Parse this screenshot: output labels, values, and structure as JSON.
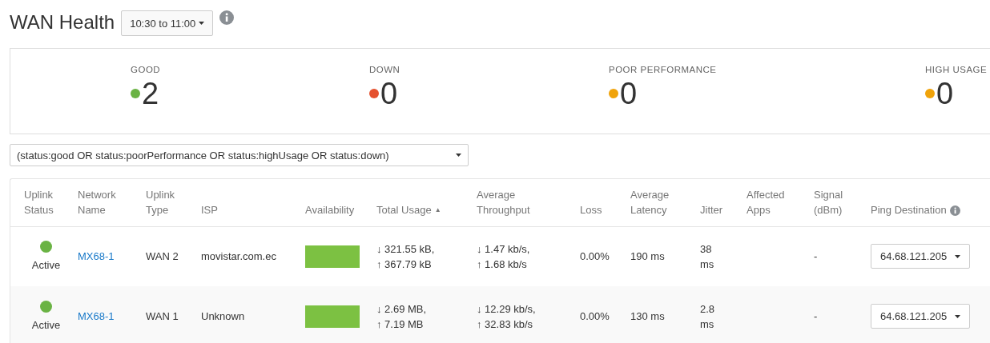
{
  "title": "WAN Health",
  "time_range": "10:30 to 11:00",
  "summary": [
    {
      "label": "GOOD",
      "count": "2",
      "color": "#6ab344"
    },
    {
      "label": "DOWN",
      "count": "0",
      "color": "#e5512f"
    },
    {
      "label": "POOR PERFORMANCE",
      "count": "0",
      "color": "#f0a30a"
    },
    {
      "label": "HIGH USAGE",
      "count": "0",
      "color": "#f0a30a"
    }
  ],
  "filter": {
    "value": "(status:good OR status:poorPerformance OR status:highUsage OR status:down)"
  },
  "table": {
    "columns": [
      {
        "label": "Uplink Status"
      },
      {
        "label": "Network Name"
      },
      {
        "label": "Uplink Type"
      },
      {
        "label": "ISP"
      },
      {
        "label": "Availability"
      },
      {
        "label": "Total Usage",
        "sort_mark": "▲"
      },
      {
        "label": "Average Throughput"
      },
      {
        "label": "Loss"
      },
      {
        "label": "Average Latency"
      },
      {
        "label": "Jitter"
      },
      {
        "label": "Affected Apps"
      },
      {
        "label": "Signal (dBm)"
      },
      {
        "label": "Ping Destination",
        "info": true
      }
    ],
    "rows": [
      {
        "status": "Active",
        "color": "#6ab344",
        "network": "MX68-1",
        "type": "WAN 2",
        "isp": "movistar.com.ec",
        "usage": [
          "↓ 321.55 kB,",
          "↑ 367.79 kB"
        ],
        "throughput": [
          "↓ 1.47 kb/s,",
          "↑ 1.68 kb/s"
        ],
        "loss": "0.00%",
        "latency": "190 ms",
        "jitter": "38 ms",
        "signal": "-",
        "ping": "64.68.121.205"
      },
      {
        "status": "Active",
        "color": "#6ab344",
        "network": "MX68-1",
        "type": "WAN 1",
        "isp": "Unknown",
        "usage": [
          "↓ 2.69 MB,",
          "↑ 7.19 MB"
        ],
        "throughput": [
          "↓ 12.29 kb/s,",
          "↑ 32.83 kb/s"
        ],
        "loss": "0.00%",
        "latency": "130 ms",
        "jitter": "2.8 ms",
        "signal": "-",
        "ping": "64.68.121.205"
      }
    ]
  }
}
